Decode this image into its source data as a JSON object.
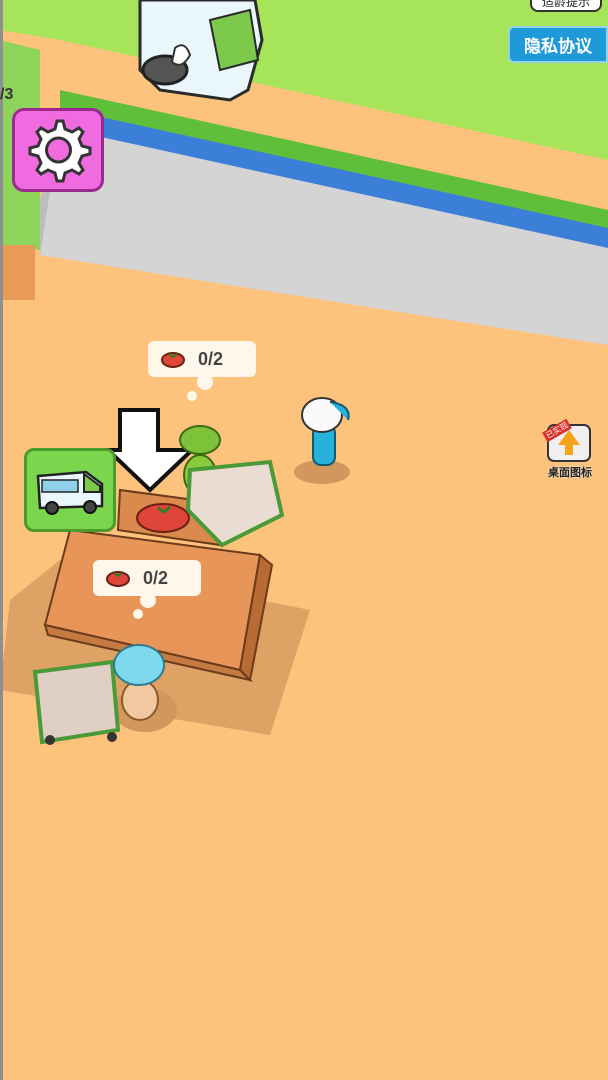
{
  "hud": {
    "age_tip": "适龄提示",
    "privacy": "隐私协议",
    "progress_counter": "/3",
    "desktop_icon_label": "桌面图标",
    "desktop_badge": "已实现"
  },
  "bubbles": {
    "top_count": "0/2",
    "counter_count": "0/2"
  },
  "icons": {
    "settings": "gear-icon",
    "van": "van-icon",
    "tomato": "tomato-icon",
    "arrow": "down-arrow-icon"
  },
  "colors": {
    "floor": "#fdc27c",
    "grass": "#a6e45a",
    "wall": "#d4d4d4",
    "wall_stripe": "#3c7fd9",
    "settings_bg": "#f06ae0",
    "van_btn_bg": "#7bd64e",
    "privacy_bg": "#1f9ad9"
  }
}
